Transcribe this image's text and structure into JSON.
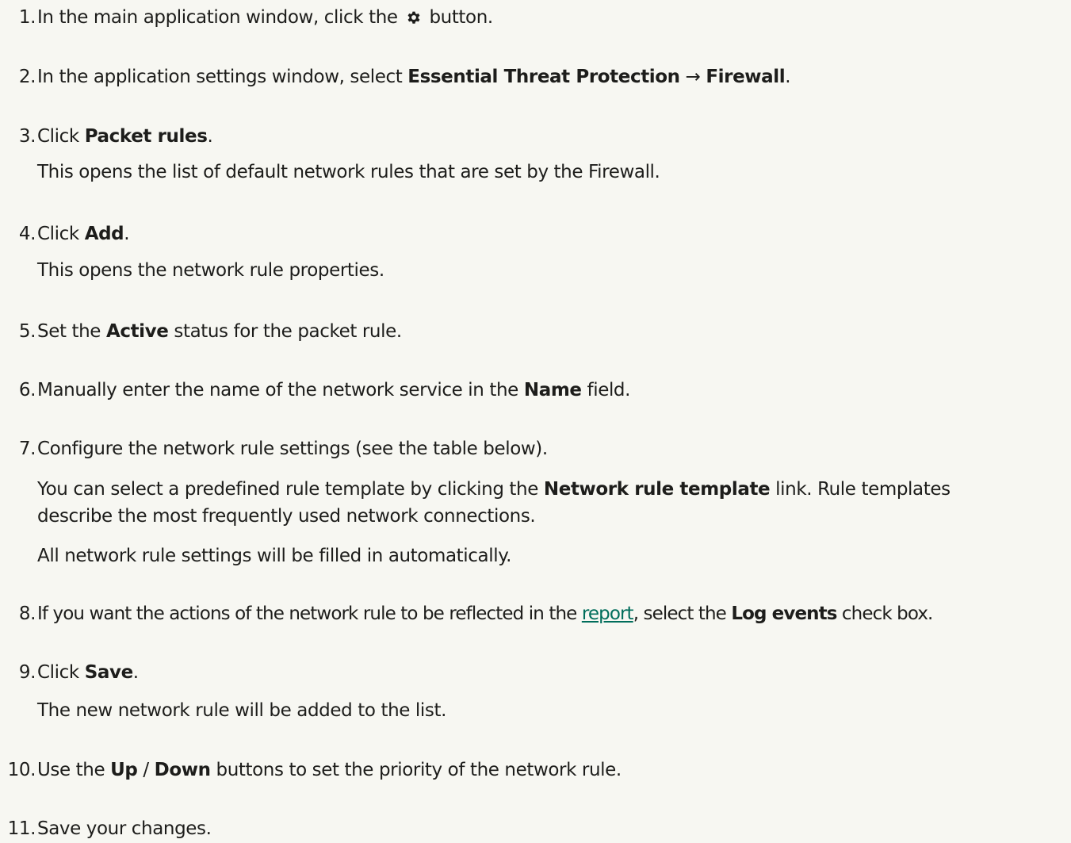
{
  "steps": [
    {
      "num": "1.",
      "parts": [
        "In the main application window, click the ",
        "",
        " button."
      ],
      "icon": "gear-icon"
    },
    {
      "num": "2.",
      "parts": [
        "In the application settings window, select ",
        "Essential Threat Protection",
        " → ",
        "Firewall",
        "."
      ]
    },
    {
      "num": "3.",
      "parts": [
        "Click ",
        "Packet rules",
        "."
      ],
      "note": "This opens the list of default network rules that are set by the Firewall."
    },
    {
      "num": "4.",
      "parts": [
        "Click ",
        "Add",
        "."
      ],
      "note": "This opens the network rule properties."
    },
    {
      "num": "5.",
      "parts": [
        "Set the ",
        "Active",
        " status for the packet rule."
      ]
    },
    {
      "num": "6.",
      "parts": [
        "Manually enter the name of the network service in the ",
        "Name",
        " field."
      ]
    },
    {
      "num": "7.",
      "parts": [
        "Configure the network rule settings (see the table below)."
      ],
      "note_parts": [
        "You can select a predefined rule template by clicking the ",
        "Network rule template",
        " link. Rule templates"
      ],
      "note_line2": "describe the most frequently used network connections.",
      "note2": "All network rule settings will be filled in automatically."
    },
    {
      "num": "8.",
      "parts": [
        "If you want the actions of the network rule to be reflected in the ",
        "report",
        ", select the ",
        "Log events",
        " check box."
      ]
    },
    {
      "num": "9.",
      "parts": [
        "Click ",
        "Save",
        "."
      ],
      "note": "The new network rule will be added to the list."
    },
    {
      "num": "10.",
      "parts": [
        "Use the ",
        "Up",
        " / ",
        "Down",
        " buttons to set the priority of the network rule."
      ]
    },
    {
      "num": "11.",
      "parts": [
        "Save your changes."
      ]
    }
  ],
  "colors": {
    "background": "#f7f7f2",
    "text": "#1d1d1b",
    "link": "#006d5b"
  }
}
